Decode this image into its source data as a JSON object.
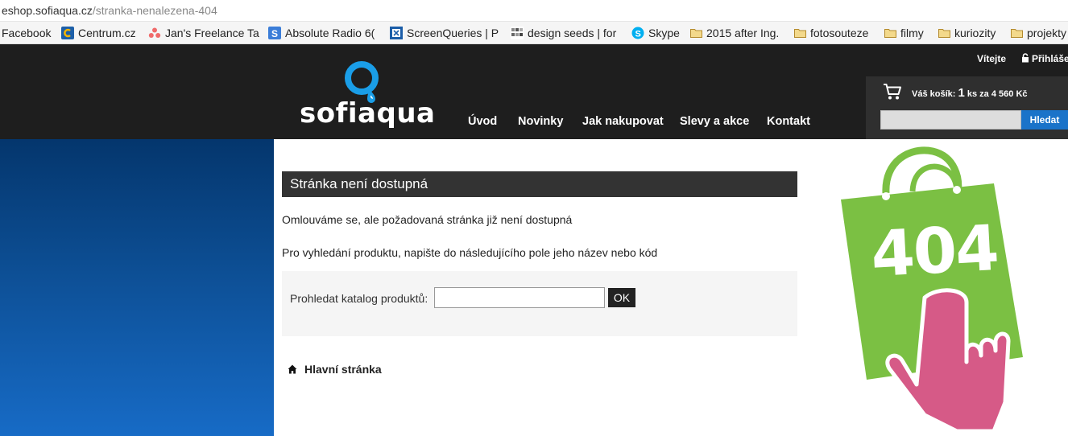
{
  "browser": {
    "url_domain": "eshop.sofiaqua.cz",
    "url_path": "/stranka-nenalezena-404",
    "bookmarks": [
      {
        "label": "Facebook",
        "icon": "facebook-icon"
      },
      {
        "label": "Centrum.cz",
        "icon": "centrum-icon"
      },
      {
        "label": "Jan's Freelance Ta",
        "icon": "asana-icon"
      },
      {
        "label": "Absolute Radio 6(",
        "icon": "absolute-radio-icon"
      },
      {
        "label": "ScreenQueries | P",
        "icon": "screenqueries-icon"
      },
      {
        "label": "design seeds | for",
        "icon": "design-seeds-icon"
      },
      {
        "label": "Skype",
        "icon": "skype-icon"
      },
      {
        "label": "2015 after Ing.",
        "icon": "folder-icon"
      },
      {
        "label": "fotosouteze",
        "icon": "folder-icon"
      },
      {
        "label": "filmy",
        "icon": "folder-icon"
      },
      {
        "label": "kuriozity",
        "icon": "folder-icon"
      },
      {
        "label": "projekty",
        "icon": "folder-icon"
      }
    ]
  },
  "header": {
    "logo_text": "sofiaqua",
    "nav": [
      "Úvod",
      "Novinky",
      "Jak nakupovat",
      "Slevy a akce",
      "Kontakt"
    ],
    "welcome": "Vítejte",
    "login": "Přihláše",
    "cart": {
      "label": "Váš košík:",
      "count": "1",
      "summary": "ks za 4 560 Kč"
    },
    "search_button": "Hledat"
  },
  "main": {
    "heading": "Stránka není dostupná",
    "apology": "Omlouváme se, ale požadovaná stránka již není dostupná",
    "hint": "Pro vyhledání produktu, napište do následujícího pole jeho název nebo kód",
    "catalog_label": "Prohledat katalog produktů:",
    "catalog_value": "",
    "ok_label": "OK",
    "home_link": "Hlavní stránka",
    "error_code": "404"
  },
  "colors": {
    "header_bg": "#1e1e1e",
    "accent_blue": "#1a73c9",
    "bag_green": "#7bc043",
    "hand_pink": "#d65a87"
  }
}
